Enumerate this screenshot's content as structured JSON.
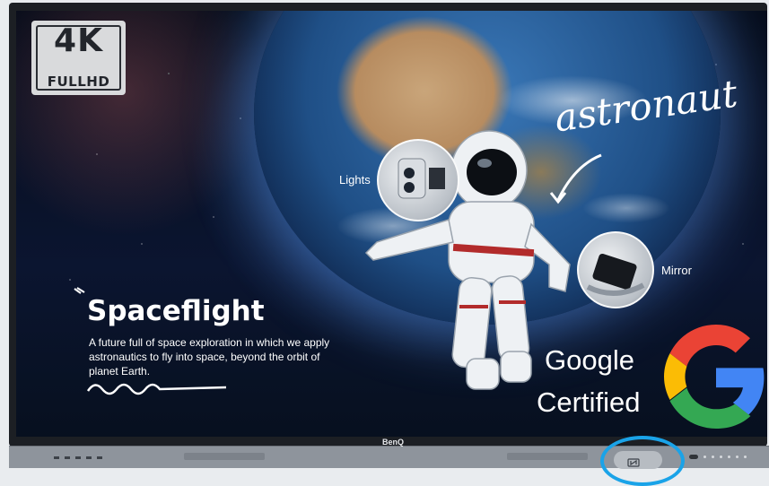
{
  "badge": {
    "resolution": "4K",
    "label": "FULLHD"
  },
  "screen": {
    "handwritten_label": "astronaut",
    "callouts": {
      "lights": "Lights",
      "mirror": "Mirror"
    },
    "title": "Spaceflight",
    "description": "A future full of space exploration in which we apply astronautics to fly into space, beyond the orbit of planet Earth."
  },
  "certification": {
    "line1": "Google",
    "line2": "Certified"
  },
  "device": {
    "brand": "BenQ"
  },
  "colors": {
    "nfc_highlight": "#1aa3e8",
    "google_blue": "#4285F4",
    "google_red": "#EA4335",
    "google_yellow": "#FBBC05",
    "google_green": "#34A853"
  },
  "icons": {
    "nfc": "nfc-icon",
    "google": "google-g-logo"
  }
}
